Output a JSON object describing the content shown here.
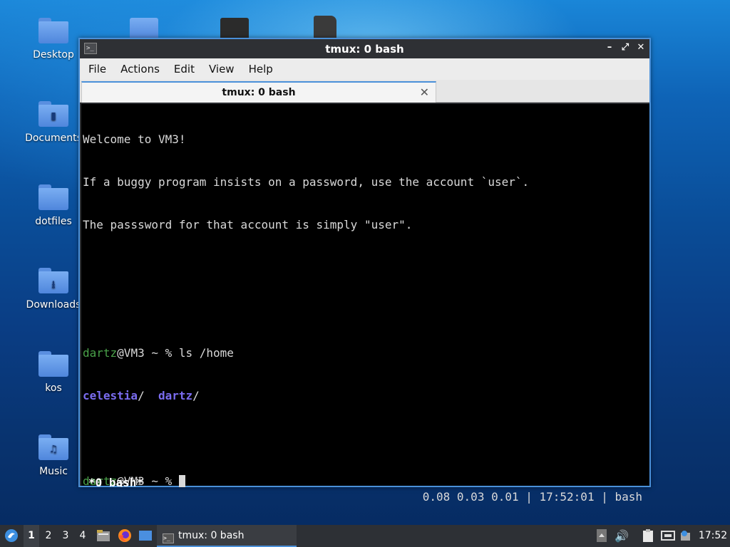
{
  "desktop": {
    "icons": [
      {
        "label": "Desktop"
      },
      {
        "label": "Documents"
      },
      {
        "label": "dotfiles"
      },
      {
        "label": "Downloads"
      },
      {
        "label": "kos"
      },
      {
        "label": "Music"
      }
    ]
  },
  "window": {
    "title": "tmux: 0 bash",
    "controls": {
      "minimize": "–",
      "maximize": "⤢",
      "close": "✕"
    },
    "menu": [
      "File",
      "Actions",
      "Edit",
      "View",
      "Help"
    ],
    "tab": {
      "label": "tmux: 0 bash",
      "close": "✕"
    },
    "terminal": {
      "lines": [
        "Welcome to VM3!",
        "If a buggy program insists on a password, use the account `user`.",
        "The passsword for that account is simply \"user\"."
      ],
      "prompt_user": "dartz",
      "prompt_rest": "@VM3 ~ % ",
      "command": "ls /home",
      "ls_output": [
        {
          "name": "celestia",
          "suffix": "/  "
        },
        {
          "name": "dartz",
          "suffix": "/"
        }
      ],
      "status_left": "*0 bash*",
      "status_right": "0.08 0.03 0.01 | 17:52:01 | bash"
    }
  },
  "taskbar": {
    "workspaces": [
      "1",
      "2",
      "3",
      "4"
    ],
    "active_workspace": "1",
    "task_label": "tmux: 0 bash",
    "clock": "17:52"
  },
  "colors": {
    "accent": "#4a90d9",
    "prompt_user": "#4aa24a",
    "dir": "#7a6cf0"
  }
}
